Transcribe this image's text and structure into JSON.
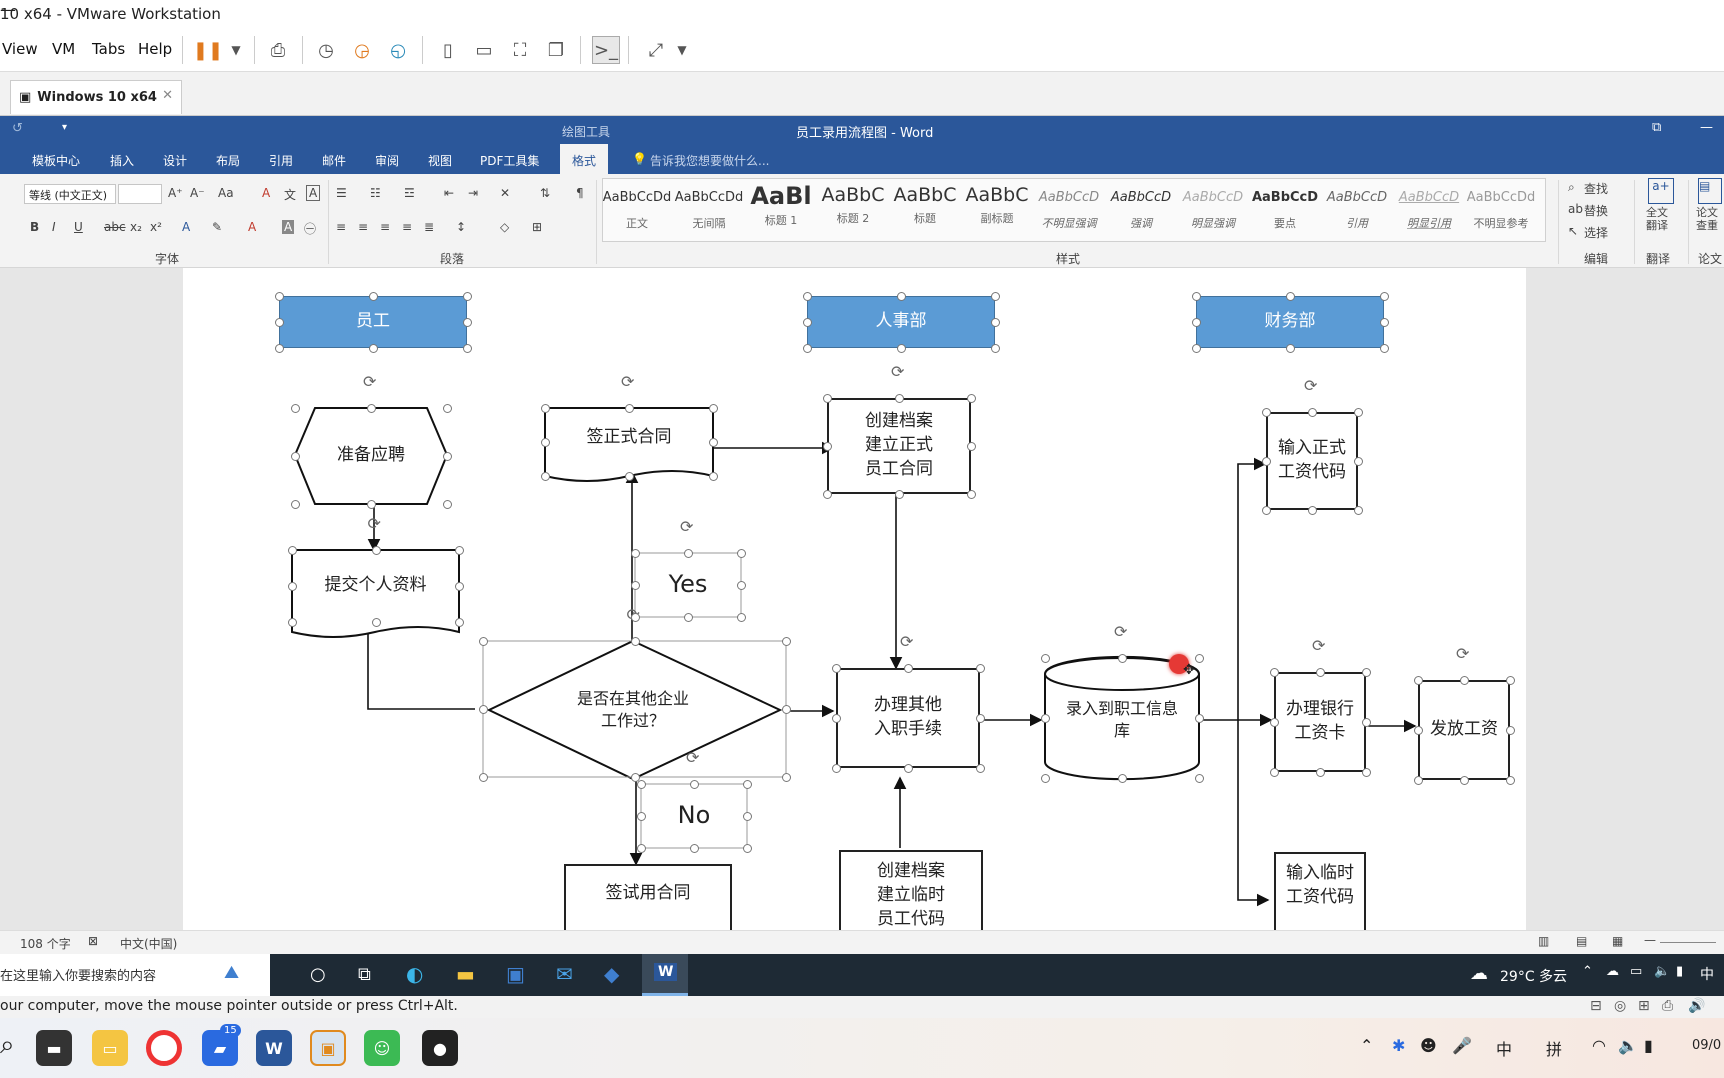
{
  "vm": {
    "title": "10 x64 - VMware Workstation",
    "menu": [
      "View",
      "VM",
      "Tabs",
      "Help"
    ],
    "tab_label": "Windows 10 x64",
    "hint": "our computer, move the mouse pointer outside or press Ctrl+Alt."
  },
  "word": {
    "title": "员工录用流程图 - Word",
    "context_tab": "绘图工具",
    "tabs": [
      "模板中心",
      "插入",
      "设计",
      "布局",
      "引用",
      "邮件",
      "审阅",
      "视图",
      "PDF工具集",
      "格式"
    ],
    "tell_me": "告诉我您想要做什么...",
    "font_name": "等线 (中文正文)",
    "groups": {
      "font": "字体",
      "paragraph": "段落",
      "styles": "样式",
      "editing": "编辑",
      "translate": "翻译",
      "paper": "论文"
    },
    "styles": [
      {
        "prev": "AaBbCcDd",
        "name": "正文"
      },
      {
        "prev": "AaBbCcDd",
        "name": "无间隔"
      },
      {
        "prev": "AaBl",
        "name": "标题 1"
      },
      {
        "prev": "AaBbC",
        "name": "标题 2"
      },
      {
        "prev": "AaBbC",
        "name": "标题"
      },
      {
        "prev": "AaBbC",
        "name": "副标题"
      },
      {
        "prev": "AaBbCcD",
        "name": "不明显强调"
      },
      {
        "prev": "AaBbCcD",
        "name": "强调"
      },
      {
        "prev": "AaBbCcD",
        "name": "明显强调"
      },
      {
        "prev": "AaBbCcD",
        "name": "要点"
      },
      {
        "prev": "AaBbCcD",
        "name": "引用"
      },
      {
        "prev": "AaBbCcD",
        "name": "明显引用"
      },
      {
        "prev": "AaBbCcDd",
        "name": "不明显参考"
      }
    ],
    "edit": {
      "find": "查找",
      "replace": "替换",
      "select": "选择"
    },
    "translate": "全文翻译",
    "paper": "论文查重",
    "status": {
      "words": "108 个字",
      "lang": "中文(中国)"
    }
  },
  "flow": {
    "h_emp": "员工",
    "h_hr": "人事部",
    "h_fin": "财务部",
    "prepare": "准备应聘",
    "submit": "提交个人资料",
    "formal_contract": "签正式合同",
    "yes": "Yes",
    "no": "No",
    "decision": "是否在其他企业\n工作过？",
    "trial": "签试用合同",
    "archive_formal": "创建档案\n建立正式\n员工合同",
    "other": "办理其他\n入职手续",
    "archive_temp": "创建档案\n建立临时\n员工代码",
    "db": "录入到职工信息\n库",
    "fin_formal": "输入正式\n工资代码",
    "bank": "办理银行\n工资卡",
    "pay": "发放工资",
    "fin_temp": "输入临时\n工资代码"
  },
  "guest_taskbar": {
    "search": "在这里输入你要搜索的内容",
    "weather": "29°C 多云",
    "ime": "中"
  },
  "host_taskbar": {
    "badge": "15",
    "ime1": "中",
    "ime2": "拼",
    "date": "09/0"
  }
}
